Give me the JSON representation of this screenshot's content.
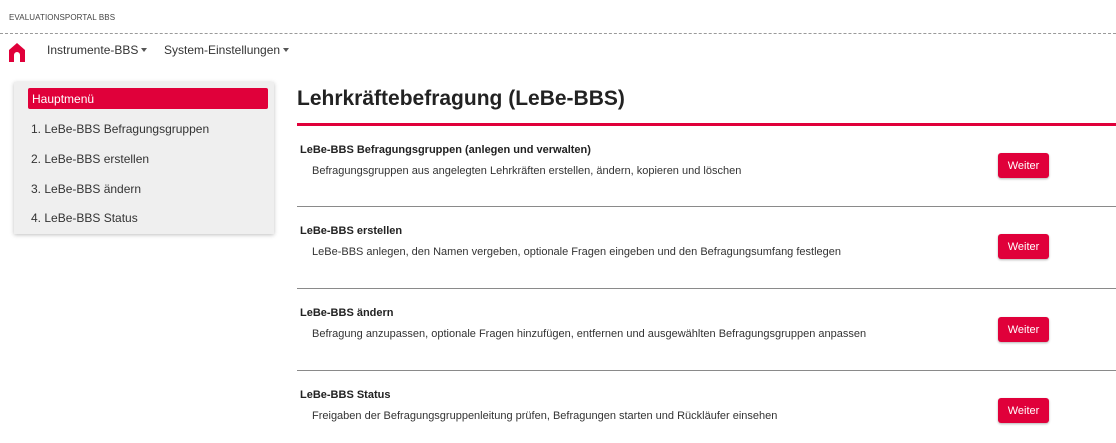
{
  "header": {
    "portal_title": "EVALUATIONSPORTAL BBS"
  },
  "navbar": {
    "home_icon": "home-icon",
    "menus": [
      {
        "label": "Instrumente-BBS"
      },
      {
        "label": "System-Einstellungen"
      }
    ]
  },
  "sidebar": {
    "heading": "Hauptmenü",
    "items": [
      {
        "label": "1. LeBe-BBS Befragungsgruppen"
      },
      {
        "label": "2. LeBe-BBS erstellen"
      },
      {
        "label": "3. LeBe-BBS ändern"
      },
      {
        "label": "4. LeBe-BBS Status"
      }
    ]
  },
  "main": {
    "title": "Lehrkräftebefragung (LeBe-BBS)",
    "sections": [
      {
        "title": "LeBe-BBS Befragungsgruppen (anlegen und verwalten)",
        "description": "Befragungsgruppen aus angelegten Lehrkräften erstellen, ändern, kopieren und löschen",
        "button": "Weiter"
      },
      {
        "title": "LeBe-BBS erstellen",
        "description": "LeBe-BBS anlegen, den Namen vergeben, optionale Fragen eingeben und den Befragungsumfang festlegen",
        "button": "Weiter"
      },
      {
        "title": "LeBe-BBS ändern",
        "description": "Befragung anzupassen, optionale Fragen hinzufügen, entfernen und ausgewählten Befragungsgruppen anpassen",
        "button": "Weiter"
      },
      {
        "title": "LeBe-BBS Status",
        "description": "Freigaben der Befragungsgruppenleitung prüfen, Befragungen starten und Rückläufer einsehen",
        "button": "Weiter"
      }
    ]
  },
  "colors": {
    "accent": "#e0003a"
  }
}
